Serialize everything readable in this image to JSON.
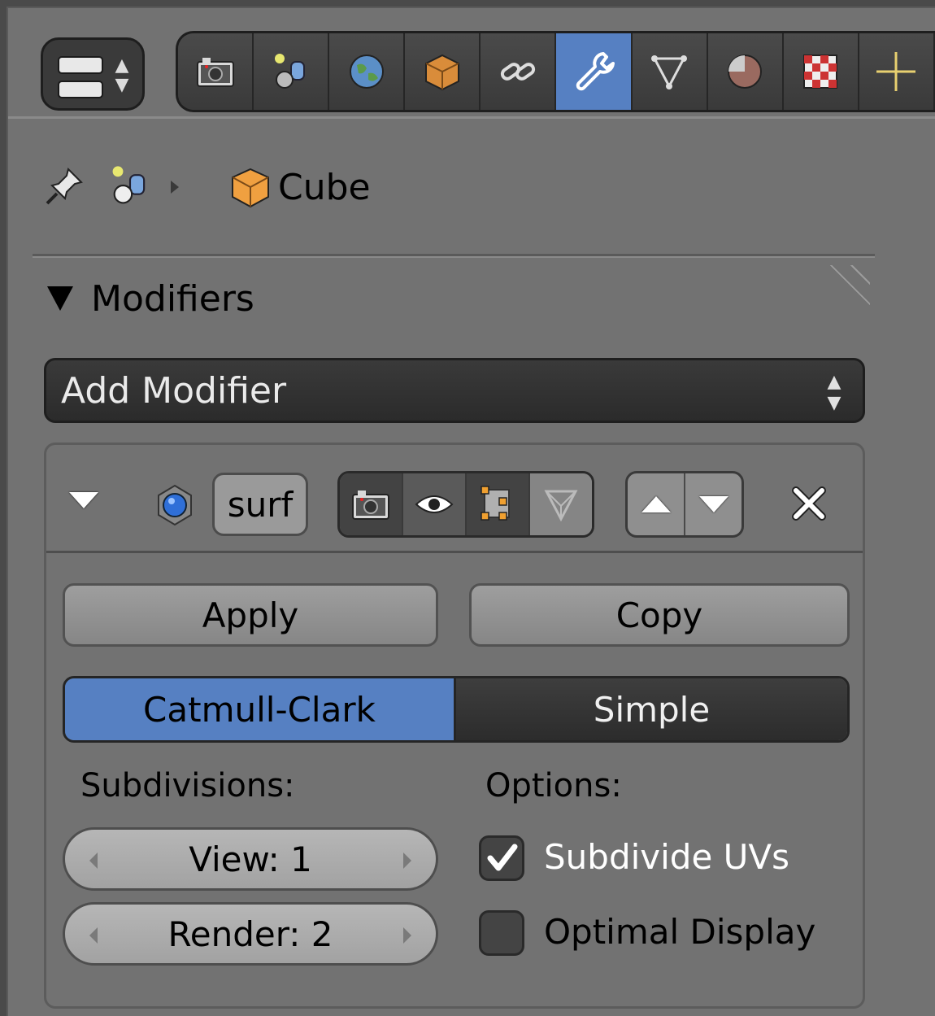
{
  "header": {
    "tabs": [
      {
        "icon": "render-camera-icon"
      },
      {
        "icon": "scene-icon"
      },
      {
        "icon": "world-icon"
      },
      {
        "icon": "object-icon"
      },
      {
        "icon": "constraints-icon"
      },
      {
        "icon": "modifiers-wrench-icon",
        "active": true
      },
      {
        "icon": "mesh-data-icon"
      },
      {
        "icon": "material-icon"
      },
      {
        "icon": "texture-icon"
      },
      {
        "icon": "particles-icon"
      }
    ]
  },
  "breadcrumb": {
    "object_name": "Cube"
  },
  "section": {
    "title": "Modifiers"
  },
  "add_modifier": {
    "label": "Add Modifier"
  },
  "modifier": {
    "name": "surf",
    "apply_label": "Apply",
    "copy_label": "Copy",
    "mode_options": [
      "Catmull-Clark",
      "Simple"
    ],
    "selected_mode": "Catmull-Clark",
    "subdivisions_label": "Subdivisions:",
    "options_label": "Options:",
    "view_field": "View: 1",
    "render_field": "Render: 2",
    "subdivide_uvs_label": "Subdivide UVs",
    "subdivide_uvs_checked": true,
    "optimal_display_label": "Optimal Display",
    "optimal_display_checked": false
  },
  "colors": {
    "accent": "#5680c2",
    "panel": "#727272"
  }
}
